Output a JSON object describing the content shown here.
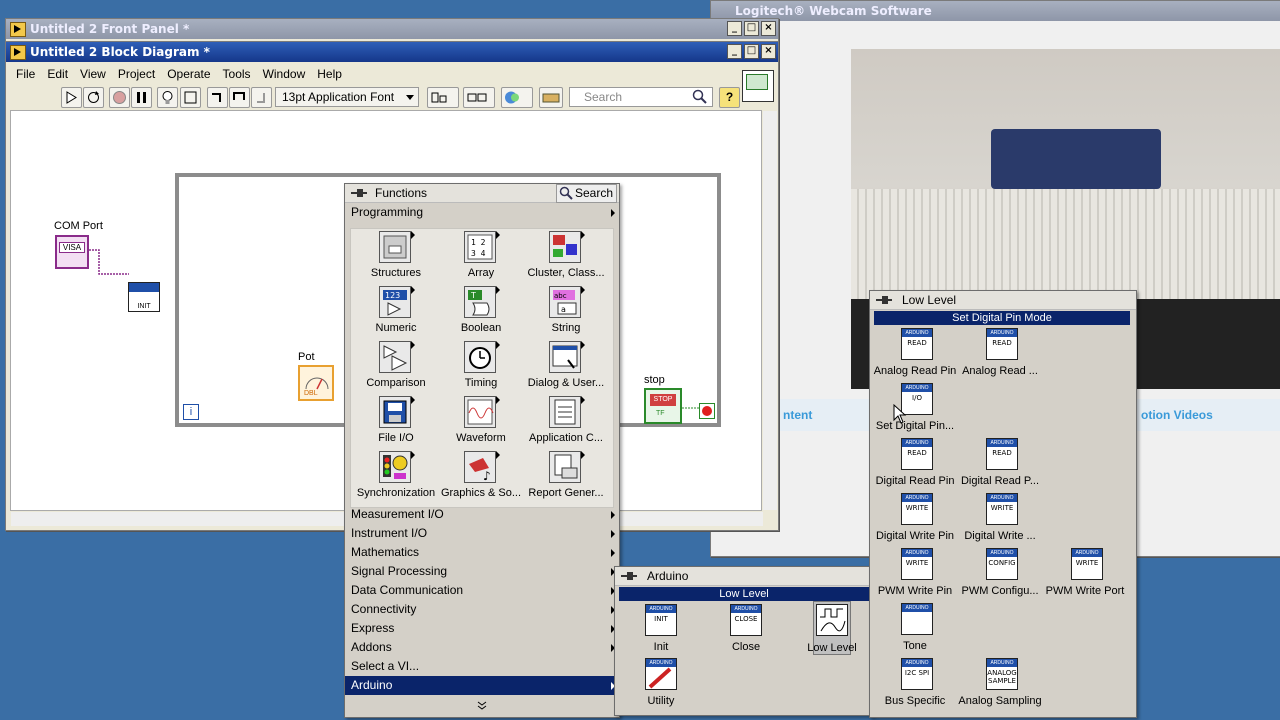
{
  "webcam_window": {
    "title": "Logitech® Webcam Software",
    "tab_content": "ntent",
    "tab_videos": "otion Videos"
  },
  "front_panel": {
    "title": "Untitled 2 Front Panel *"
  },
  "block_diagram": {
    "title": "Untitled 2 Block Diagram *",
    "menu": [
      "File",
      "Edit",
      "View",
      "Project",
      "Operate",
      "Tools",
      "Window",
      "Help"
    ],
    "font_select": "13pt Application Font",
    "search_placeholder": "Search",
    "com_port_label": "COM Port",
    "visa_text": "VISA",
    "init_text": "INIT",
    "pot_label": "Pot",
    "pot_dbl": "DBL",
    "stop_label": "stop",
    "stop_button_text": "STOP",
    "stop_tf": "TF",
    "loop_iter": "i"
  },
  "functions_palette": {
    "title": "Functions",
    "search_label": "Search",
    "section": "Programming",
    "items": [
      {
        "label": "Structures"
      },
      {
        "label": "Array"
      },
      {
        "label": "Cluster, Class..."
      },
      {
        "label": "Numeric"
      },
      {
        "label": "Boolean"
      },
      {
        "label": "String"
      },
      {
        "label": "Comparison"
      },
      {
        "label": "Timing"
      },
      {
        "label": "Dialog & User..."
      },
      {
        "label": "File I/O"
      },
      {
        "label": "Waveform"
      },
      {
        "label": "Application C..."
      },
      {
        "label": "Synchronization"
      },
      {
        "label": "Graphics & So..."
      },
      {
        "label": "Report Gener..."
      }
    ],
    "categories": [
      "Measurement I/O",
      "Instrument I/O",
      "Mathematics",
      "Signal Processing",
      "Data Communication",
      "Connectivity",
      "Express",
      "Addons",
      "Select a VI...",
      "Arduino"
    ],
    "selected_category": "Arduino"
  },
  "arduino_palette": {
    "title": "Arduino",
    "header": "Low Level",
    "items": [
      {
        "label": "Init",
        "glyph": "INIT"
      },
      {
        "label": "Close",
        "glyph": "CLOSE"
      },
      {
        "label": "Low Level",
        "glyph": ""
      },
      {
        "label": "Utility",
        "glyph": ""
      }
    ]
  },
  "low_level_palette": {
    "title": "Low Level",
    "tooltip": "Set Digital Pin Mode",
    "items": [
      {
        "label": "Analog Read Pin",
        "glyph": "READ"
      },
      {
        "label": "Analog Read ...",
        "glyph": "READ"
      },
      {
        "label": "Set Digital Pin...",
        "glyph": "I/O"
      },
      {
        "label": "Digital Read Pin",
        "glyph": "READ"
      },
      {
        "label": "Digital Read P...",
        "glyph": "READ"
      },
      {
        "label": "Digital Write Pin",
        "glyph": "WRITE"
      },
      {
        "label": "Digital Write ...",
        "glyph": "WRITE"
      },
      {
        "label": "PWM Write Pin",
        "glyph": "WRITE"
      },
      {
        "label": "PWM Configu...",
        "glyph": "CONFIG"
      },
      {
        "label": "PWM Write Port",
        "glyph": "WRITE"
      },
      {
        "label": "Tone",
        "glyph": ""
      },
      {
        "label": "Bus Specific",
        "glyph": "I2C SPI"
      },
      {
        "label": "Analog Sampling",
        "glyph": "ANALOG SAMPLE"
      }
    ]
  }
}
